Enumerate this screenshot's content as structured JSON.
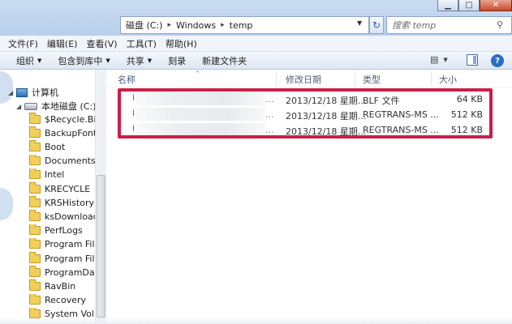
{
  "window": {
    "minimize_glyph": "▁",
    "maximize_glyph": "□",
    "close_glyph": "✕"
  },
  "address": {
    "segments": [
      "磁盘 (C:)",
      "Windows",
      "temp"
    ],
    "separator": "▸",
    "dropdown_glyph": "▼",
    "refresh_glyph": "↻"
  },
  "search": {
    "placeholder": "搜索 temp",
    "icon": "search-icon",
    "icon_glyph": "⚲"
  },
  "menu": [
    "文件(F)",
    "编辑(E)",
    "查看(V)",
    "工具(T)",
    "帮助(H)"
  ],
  "toolbar": {
    "organize": "组织",
    "include_in_library": "包含到库中",
    "share": "共享",
    "burn": "刻录",
    "new_folder": "新建文件夹",
    "dropdown_glyph": "▼",
    "views_glyph": "▤",
    "help_glyph": "?"
  },
  "nav": {
    "computer": "计算机",
    "local_disk": "本地磁盘 (C:)",
    "folders": [
      "$Recycle.Bin",
      "BackupFonts",
      "Boot",
      "Documents and",
      "Intel",
      "KRECYCLE",
      "KRSHistory",
      "ksDownloads",
      "PerfLogs",
      "Program Files",
      "Program Files (",
      "ProgramData",
      "RavBin",
      "Recovery",
      "System Volume"
    ],
    "expand_glyph": "▷",
    "collapse_glyph": "◢"
  },
  "columns": {
    "name": "名称",
    "modified": "修改日期",
    "type": "类型",
    "size": "大小",
    "sort_glyph": "^"
  },
  "files": [
    {
      "name_mark": "l",
      "ellipsis": "...",
      "modified": "2013/12/18 星期...",
      "type": "BLF 文件",
      "size": "64 KB"
    },
    {
      "name_mark": "l",
      "ellipsis": "...",
      "modified": "2013/12/18 星期...",
      "type": "REGTRANS-MS ...",
      "size": "512 KB"
    },
    {
      "name_mark": "l",
      "ellipsis": "...",
      "modified": "2013/12/18 星期...",
      "type": "REGTRANS-MS ...",
      "size": "512 KB"
    }
  ],
  "highlight_color": "#c8204a"
}
